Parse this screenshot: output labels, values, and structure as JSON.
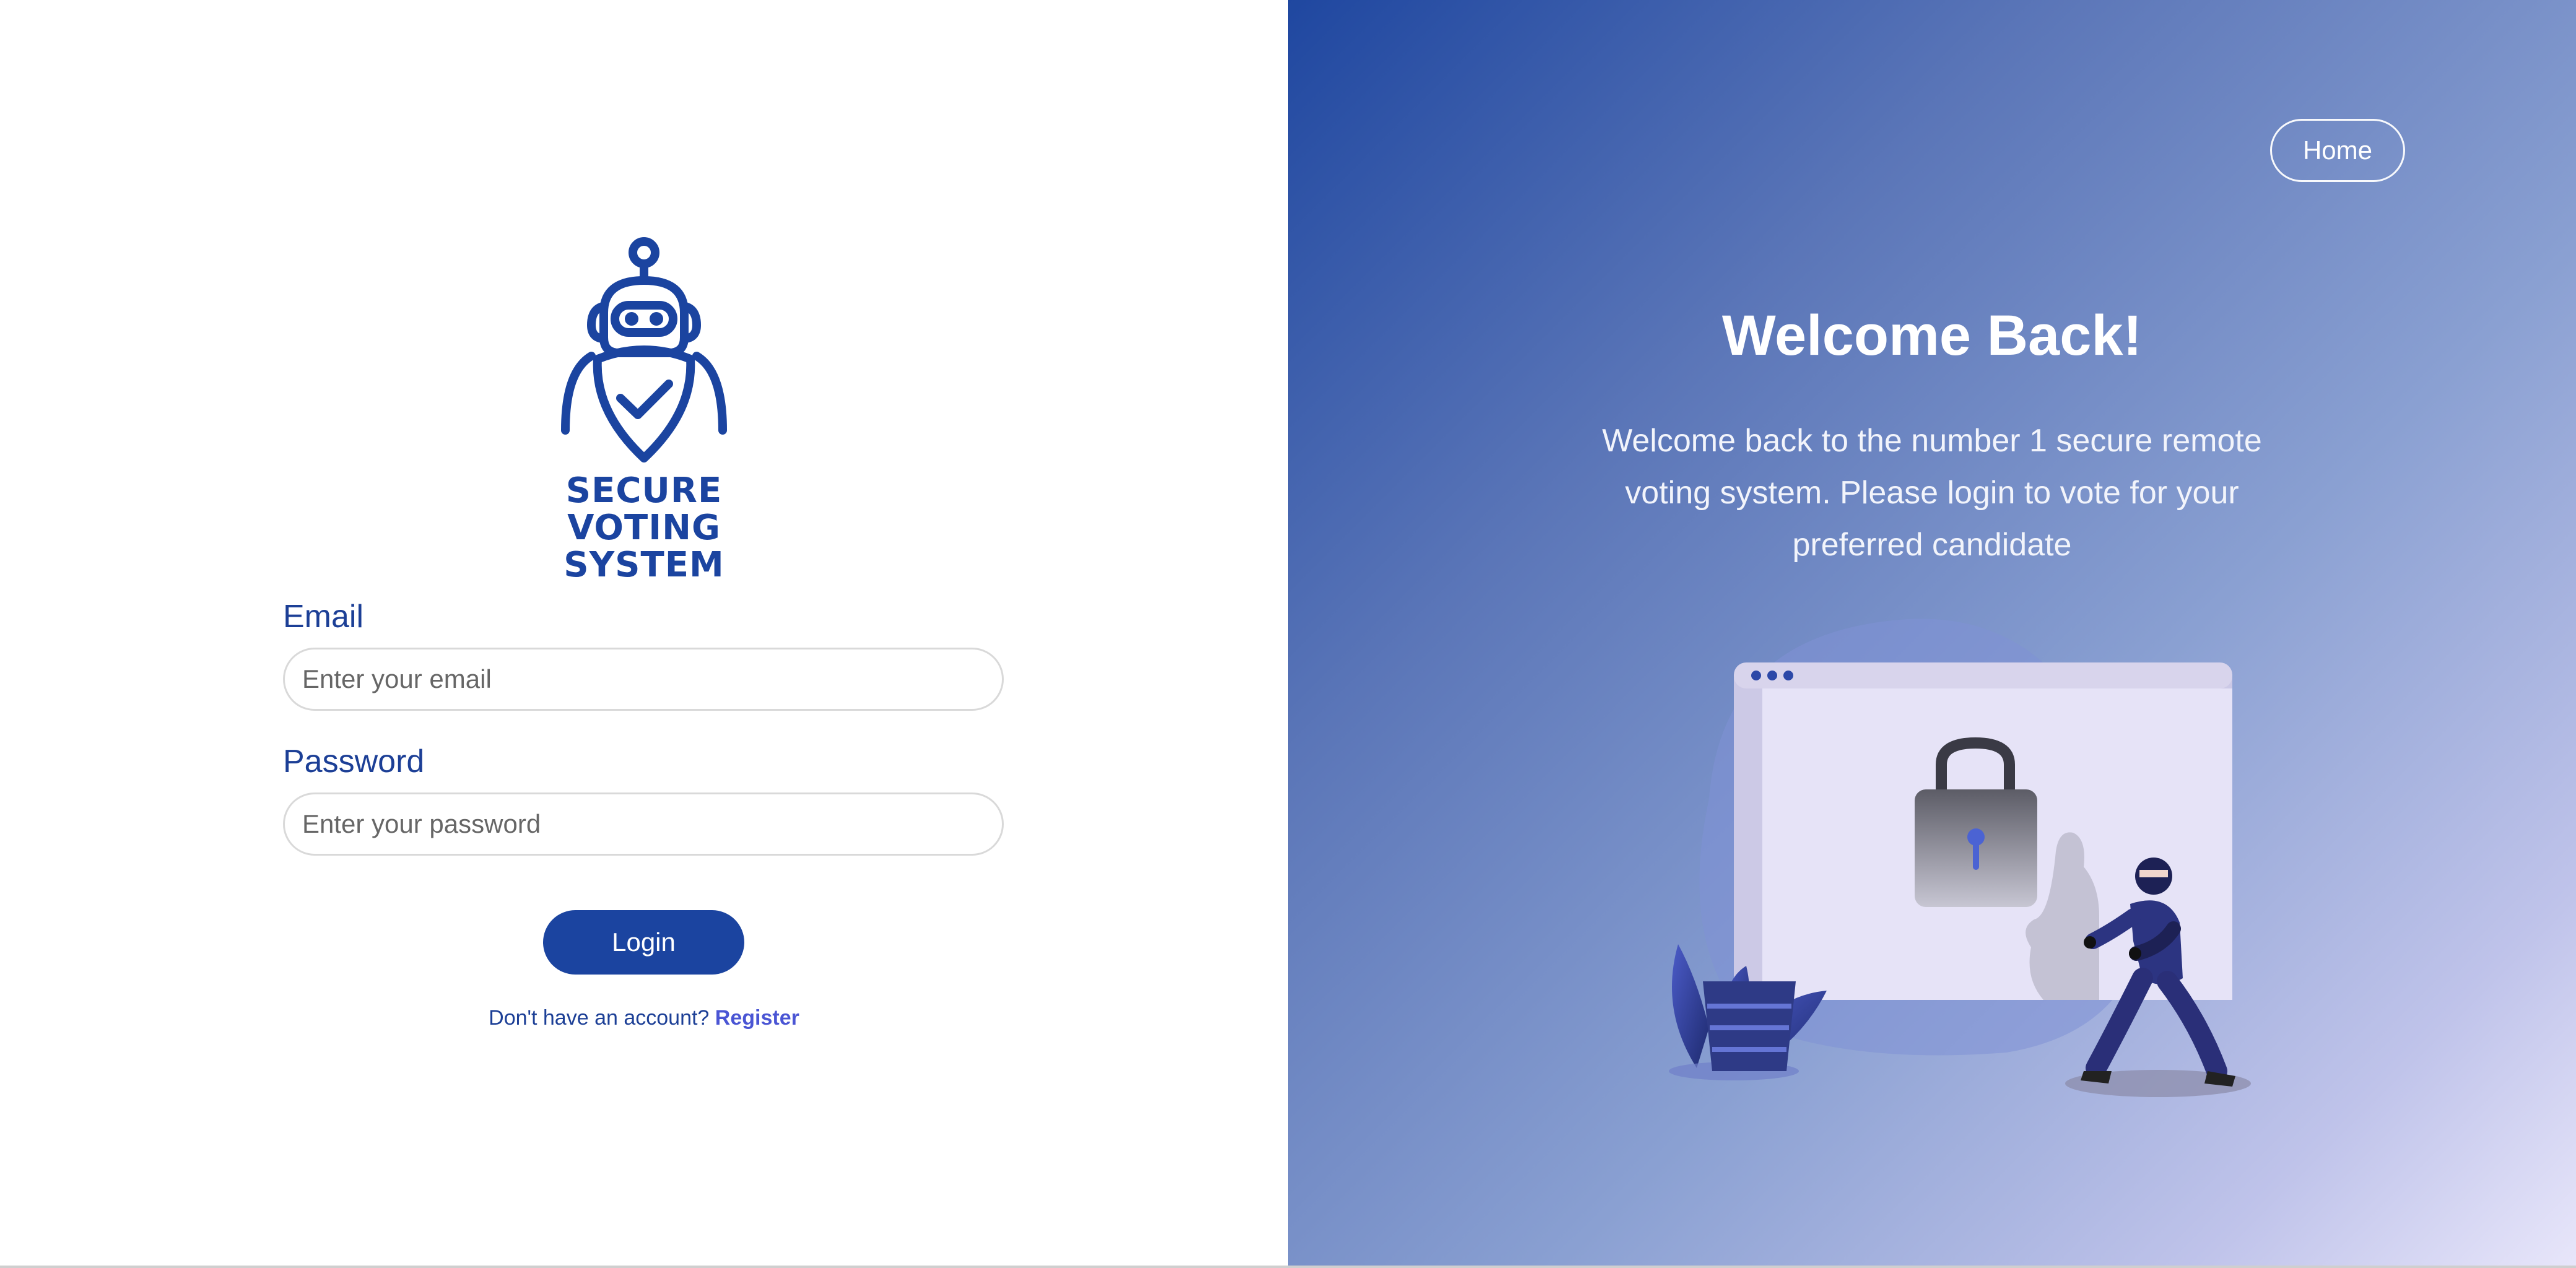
{
  "brand": {
    "logo_text_line1": "SECURE VOTING",
    "logo_text_line2": "SYSTEM",
    "primary_color": "#1b44a0"
  },
  "login_form": {
    "email_label": "Email",
    "email_placeholder": "Enter your email",
    "email_value": "",
    "password_label": "Password",
    "password_placeholder": "Enter your password",
    "password_value": "",
    "login_button": "Login",
    "register_prompt": "Don't have an account?",
    "register_link": "Register"
  },
  "hero": {
    "home_button": "Home",
    "title": "Welcome Back!",
    "description": "Welcome back to the number 1 secure remote voting system. Please login to vote for your preferred candidate",
    "illustration_icon": "padlock-browser-thief-illustration"
  },
  "icons": {
    "logo": "robot-shield-check-icon"
  }
}
